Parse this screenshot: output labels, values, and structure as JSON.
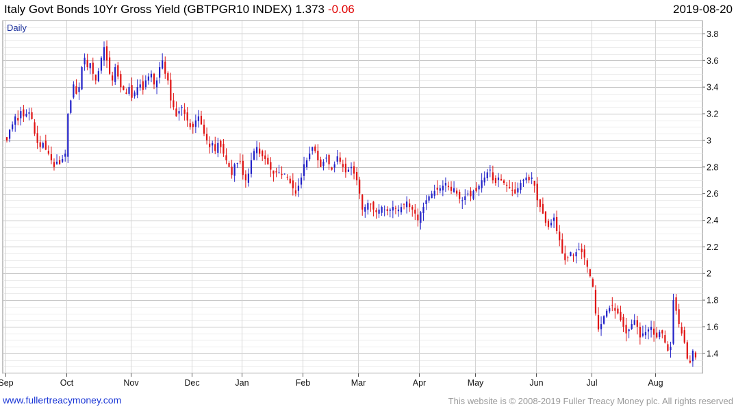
{
  "header": {
    "title": "Italy Govt Bonds 10Yr Gross Yield (GBTPGR10 INDEX)",
    "last": "1.373",
    "change": "-0.06",
    "date": "2019-08-20"
  },
  "footer": {
    "left": "www.fullertreacymoney.com",
    "right": "This website is © 2008-2019 Fuller Treacy Money plc. All rights reserved"
  },
  "colors": {
    "up": "#2323c8",
    "down": "#e01414",
    "grid": "#d4d4d4",
    "accent_change": "#e00000"
  },
  "chart_data": {
    "type": "candlestick",
    "period_label": "Daily",
    "y_axis": {
      "side": "right",
      "ylim": [
        1.25,
        3.9
      ],
      "ticks": [
        1.4,
        1.6,
        1.8,
        2,
        2.2,
        2.4,
        2.6,
        2.8,
        3,
        3.2,
        3.4,
        3.6,
        3.8
      ]
    },
    "x_axis": {
      "month_labels": [
        "Sep",
        "Oct",
        "Nov",
        "Dec",
        "Jan",
        "Feb",
        "Mar",
        "Apr",
        "May",
        "Jun",
        "Jul",
        "Aug"
      ]
    },
    "months": [
      {
        "label": "Sep",
        "closes": [
          3.0,
          3.08,
          3.12,
          3.18,
          3.15,
          3.22,
          3.18,
          3.2,
          3.21,
          3.16,
          3.05,
          2.98,
          2.95,
          2.98,
          2.93,
          2.9,
          2.85,
          2.8,
          2.84,
          2.82,
          2.86,
          2.9
        ]
      },
      {
        "label": "Oct",
        "closes": [
          3.2,
          3.3,
          3.42,
          3.35,
          3.4,
          3.55,
          3.62,
          3.55,
          3.58,
          3.5,
          3.45,
          3.52,
          3.62,
          3.7,
          3.6,
          3.5,
          3.45,
          3.55,
          3.48,
          3.4,
          3.38,
          3.35,
          3.4
        ]
      },
      {
        "label": "Nov",
        "closes": [
          3.32,
          3.36,
          3.4,
          3.42,
          3.38,
          3.45,
          3.48,
          3.5,
          3.42,
          3.45,
          3.55,
          3.6,
          3.5,
          3.45,
          3.3,
          3.25,
          3.18,
          3.22,
          3.25,
          3.2,
          3.15,
          3.1
        ]
      },
      {
        "label": "Dec",
        "closes": [
          3.1,
          3.15,
          3.18,
          3.12,
          3.05,
          3.0,
          2.95,
          2.98,
          2.92,
          2.98,
          2.95,
          2.9,
          2.85,
          2.8,
          2.74,
          2.82,
          2.83,
          2.84
        ]
      },
      {
        "label": "Jan",
        "closes": [
          2.74,
          2.7,
          2.75,
          2.85,
          2.92,
          2.95,
          2.9,
          2.88,
          2.86,
          2.82,
          2.78,
          2.75,
          2.76,
          2.76,
          2.74,
          2.75,
          2.72,
          2.68,
          2.64,
          2.6,
          2.66,
          2.72
        ]
      },
      {
        "label": "Feb",
        "closes": [
          2.82,
          2.85,
          2.9,
          2.95,
          2.92,
          2.85,
          2.8,
          2.84,
          2.87,
          2.82,
          2.78,
          2.82,
          2.88,
          2.84,
          2.8,
          2.76,
          2.78,
          2.8,
          2.75,
          2.7
        ]
      },
      {
        "label": "Mar",
        "closes": [
          2.6,
          2.48,
          2.5,
          2.53,
          2.52,
          2.48,
          2.46,
          2.48,
          2.5,
          2.48,
          2.47,
          2.48,
          2.5,
          2.49,
          2.48,
          2.5,
          2.52,
          2.54,
          2.5,
          2.48,
          2.45,
          2.4
        ]
      },
      {
        "label": "Apr",
        "closes": [
          2.46,
          2.5,
          2.55,
          2.58,
          2.6,
          2.62,
          2.63,
          2.64,
          2.66,
          2.68,
          2.65,
          2.62,
          2.64,
          2.6,
          2.56,
          2.55,
          2.58,
          2.6,
          2.58,
          2.62
        ]
      },
      {
        "label": "May",
        "closes": [
          2.62,
          2.66,
          2.7,
          2.72,
          2.76,
          2.78,
          2.7,
          2.68,
          2.72,
          2.7,
          2.68,
          2.66,
          2.64,
          2.62,
          2.6,
          2.64,
          2.68,
          2.7,
          2.72,
          2.7,
          2.72,
          2.66
        ]
      },
      {
        "label": "Jun",
        "closes": [
          2.55,
          2.5,
          2.45,
          2.38,
          2.35,
          2.38,
          2.42,
          2.32,
          2.25,
          2.15,
          2.1,
          2.12,
          2.16,
          2.14,
          2.16,
          2.18,
          2.16,
          2.12,
          2.05,
          1.98
        ]
      },
      {
        "label": "Jul",
        "closes": [
          1.9,
          1.7,
          1.58,
          1.62,
          1.68,
          1.72,
          1.74,
          1.76,
          1.72,
          1.7,
          1.65,
          1.6,
          1.55,
          1.58,
          1.62,
          1.65,
          1.6,
          1.52,
          1.55,
          1.56,
          1.58,
          1.6,
          1.54
        ]
      },
      {
        "label": "Aug",
        "closes": [
          1.52,
          1.56,
          1.55,
          1.48,
          1.42,
          1.45,
          1.8,
          1.72,
          1.62,
          1.55,
          1.48,
          1.36,
          1.33,
          1.42,
          1.37
        ]
      }
    ]
  }
}
